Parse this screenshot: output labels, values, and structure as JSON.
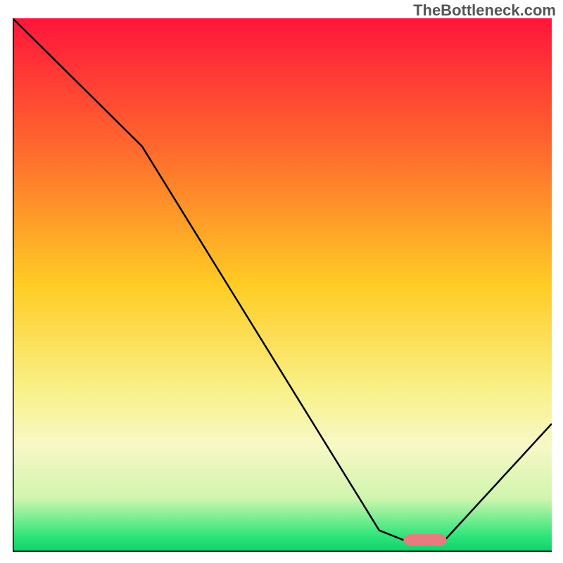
{
  "watermark": "TheBottleneck.com",
  "chart_data": {
    "type": "line",
    "title": "",
    "xlabel": "",
    "ylabel": "",
    "xlim": [
      0,
      100
    ],
    "ylim": [
      0,
      100
    ],
    "gradient_stops": [
      {
        "offset": 0,
        "color": "#ff153b"
      },
      {
        "offset": 25,
        "color": "#ff6b2d"
      },
      {
        "offset": 50,
        "color": "#ffcc24"
      },
      {
        "offset": 70,
        "color": "#f9f18a"
      },
      {
        "offset": 80,
        "color": "#f8f8c6"
      },
      {
        "offset": 90,
        "color": "#d0f5ae"
      },
      {
        "offset": 97,
        "color": "#2fe57a"
      },
      {
        "offset": 100,
        "color": "#0fd16a"
      }
    ],
    "series": [
      {
        "name": "bottleneck-curve",
        "color": "#000000",
        "width": 2.5,
        "x": [
          0,
          24,
          68,
          73,
          80,
          100
        ],
        "y": [
          100,
          76,
          4,
          2,
          2,
          24
        ]
      }
    ],
    "marker": {
      "x_center": 76.5,
      "y": 2.2,
      "width": 8,
      "height": 2.2,
      "rx": 1.6,
      "color": "#e77b7f"
    },
    "axes": {
      "left": {
        "x": 0,
        "y1": 0,
        "y2": 100
      },
      "bottom": {
        "y": 0,
        "x1": 0,
        "x2": 100
      }
    }
  }
}
